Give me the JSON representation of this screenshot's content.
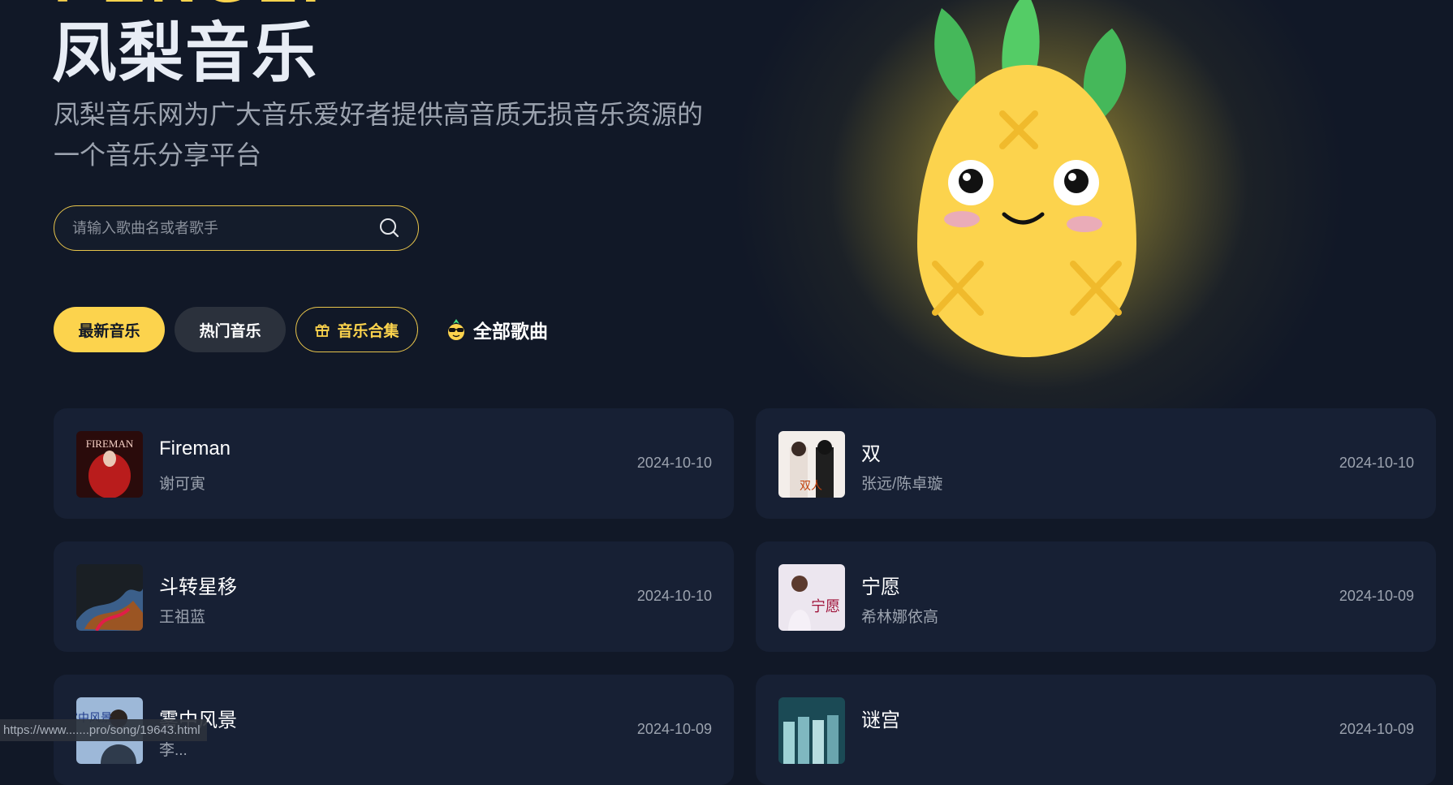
{
  "header": {
    "brand_en": "PENGLI",
    "title": "凤梨音乐",
    "subtitle": "凤梨音乐网为广大音乐爱好者提供高音质无损音乐资源的一个音乐分享平台"
  },
  "search": {
    "placeholder": "请输入歌曲名或者歌手",
    "value": "",
    "icon": "search-icon"
  },
  "tabs": [
    {
      "label": "最新音乐",
      "active": true
    },
    {
      "label": "热门音乐",
      "active": false
    },
    {
      "label": "音乐合集",
      "icon": "gift-icon",
      "active": false
    },
    {
      "label": "全部歌曲",
      "icon": "sunglasses-pineapple-icon",
      "active": false
    }
  ],
  "songs": [
    {
      "title": "Fireman",
      "artist": "谢可寅",
      "date": "2024-10-10",
      "cover_text": "FIREMAN"
    },
    {
      "title": "双",
      "artist": "张远/陈卓璇",
      "date": "2024-10-10",
      "cover_text": "双人"
    },
    {
      "title": "斗转星移",
      "artist": "王祖蓝",
      "date": "2024-10-10"
    },
    {
      "title": "宁愿",
      "artist": "希林娜依高",
      "date": "2024-10-09",
      "cover_text": "宁愿"
    },
    {
      "title": "雾中风景",
      "artist": "李...",
      "date": "2024-10-09",
      "cover_text": "雾中风景"
    },
    {
      "title": "谜宫",
      "artist": "",
      "date": "2024-10-09"
    }
  ],
  "status_bar": {
    "url": "https://www.......pro/song/19643.html"
  },
  "colors": {
    "background": "#111827",
    "accent": "#fcd34d",
    "card": "#172034",
    "muted": "#9ca3af"
  }
}
